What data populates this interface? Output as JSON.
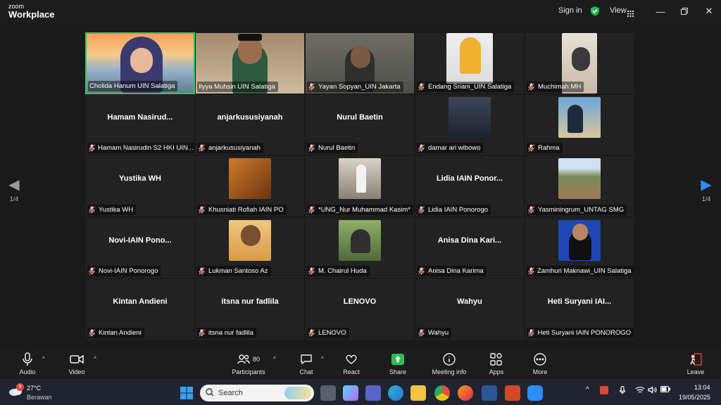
{
  "app": {
    "brand_small": "zoom",
    "brand_big": "Workplace",
    "sign_in": "Sign in",
    "view": "View"
  },
  "pager": {
    "left": "1/4",
    "right": "1/4"
  },
  "tiles": [
    {
      "name": "Cholida Hanum UIN Salatiga",
      "big": "",
      "muted": false
    },
    {
      "name": "Ilyya Muhsin UIN Salatiga",
      "big": "",
      "muted": false
    },
    {
      "name": "Yayan Sopyan_UIN Jakarta",
      "big": "",
      "muted": true
    },
    {
      "name": "Endang Sriani_UIN Salatiga",
      "big": "",
      "muted": true
    },
    {
      "name": "Muchimah MH",
      "big": "",
      "muted": true
    },
    {
      "name": "Hamam Nasirudin S2 HKI UIN...",
      "big": "Hamam  Nasirud...",
      "muted": true
    },
    {
      "name": "anjarkususiyanah",
      "big": "anjarkususiyanah",
      "muted": true
    },
    {
      "name": "Nurul Baetin",
      "big": "Nurul Baetin",
      "muted": true
    },
    {
      "name": "damar ari wibowo",
      "big": "",
      "muted": true
    },
    {
      "name": "Rahma",
      "big": "",
      "muted": true
    },
    {
      "name": "Yustika WH",
      "big": "Yustika WH",
      "muted": true
    },
    {
      "name": "Khusniati Rofiah IAIN PO",
      "big": "",
      "muted": true
    },
    {
      "name": "*UNG_Nur Muhammad Kasim*",
      "big": "",
      "muted": true
    },
    {
      "name": "Lidia IAIN Ponorogo",
      "big": "Lidia IAIN Ponor...",
      "muted": true
    },
    {
      "name": "Yasminingrum_UNTAG SMG",
      "big": "",
      "muted": true
    },
    {
      "name": "Novi-IAIN Ponorogo",
      "big": "Novi-IAIN  Pono...",
      "muted": true
    },
    {
      "name": "Lukman Santoso Az",
      "big": "",
      "muted": true
    },
    {
      "name": "M. Chairul Huda",
      "big": "",
      "muted": true
    },
    {
      "name": "Anisa Dina Karima",
      "big": "Anisa Dina Kari...",
      "muted": true
    },
    {
      "name": "Zamhuri Maknawi_UIN Salatiga",
      "big": "",
      "muted": true
    },
    {
      "name": "Kintan Andieni",
      "big": "Kintan Andieni",
      "muted": true
    },
    {
      "name": "itsna nur fadlila",
      "big": "itsna nur fadlila",
      "muted": true
    },
    {
      "name": "LENOVO",
      "big": "LENOVO",
      "muted": true
    },
    {
      "name": "Wahyu",
      "big": "Wahyu",
      "muted": true
    },
    {
      "name": "Heti Suryani IAIN PONOROGO",
      "big": "Heti Suryani IAI...",
      "muted": true
    }
  ],
  "controls": {
    "audio": "Audio",
    "video": "Video",
    "participants": "Participants",
    "participants_count": "80",
    "chat": "Chat",
    "react": "React",
    "share": "Share",
    "meeting_info": "Meeting info",
    "apps": "Apps",
    "more": "More",
    "leave": "Leave"
  },
  "taskbar": {
    "weather_temp": "27°C",
    "weather_desc": "Berawan",
    "weather_badge": "9",
    "search_placeholder": "Search",
    "time": "13:04",
    "date": "19/05/2025"
  },
  "colors": {
    "accent_green": "#3cc35b",
    "share_green": "#2bbf5a",
    "mute_red": "#e0453a",
    "leave_red": "#e0453a"
  }
}
